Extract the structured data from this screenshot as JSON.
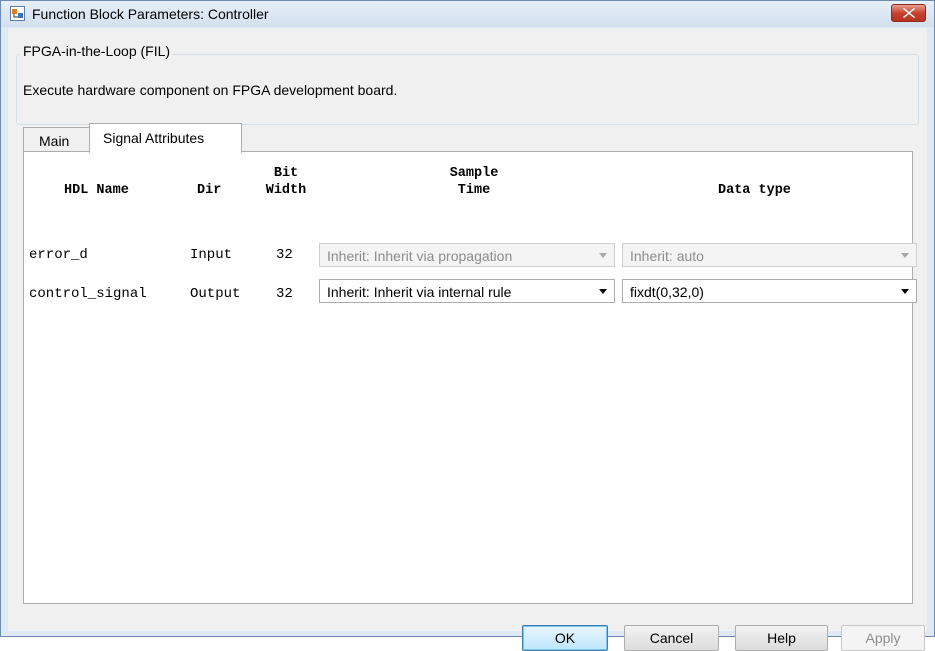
{
  "window": {
    "title": "Function Block Parameters: Controller"
  },
  "header": {
    "group_title": "FPGA-in-the-Loop (FIL)",
    "description": "Execute hardware component on FPGA development board."
  },
  "tabs": [
    {
      "label": "Main",
      "selected": false
    },
    {
      "label": "Signal Attributes",
      "selected": true
    }
  ],
  "table": {
    "columns": {
      "hdl_name": "HDL Name",
      "dir": "Dir",
      "bit_width": [
        "Bit",
        "Width"
      ],
      "sample_time": [
        "Sample",
        "Time"
      ],
      "data_type": "Data type"
    },
    "rows": [
      {
        "name": "error_d",
        "dir": "Input",
        "width": "32",
        "sample_time": "Inherit: Inherit via propagation",
        "data_type": "Inherit: auto",
        "enabled": false
      },
      {
        "name": "control_signal",
        "dir": "Output",
        "width": "32",
        "sample_time": "Inherit: Inherit via internal rule",
        "data_type": "fixdt(0,32,0)",
        "enabled": true
      }
    ]
  },
  "buttons": {
    "ok": "OK",
    "cancel": "Cancel",
    "help": "Help",
    "apply": "Apply"
  },
  "icons": {
    "app": "simulink-block-icon",
    "close": "close-icon",
    "dropdown": "chevron-down-icon"
  }
}
